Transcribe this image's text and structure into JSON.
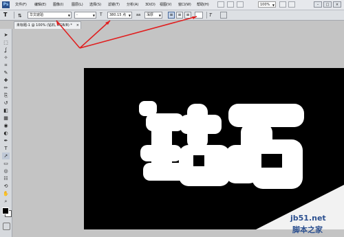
{
  "app": {
    "logo": "Ps"
  },
  "menu": {
    "items": [
      "文件(F)",
      "编辑(E)",
      "图像(I)",
      "图层(L)",
      "选择(S)",
      "滤镜(T)",
      "分析(A)",
      "3D(D)",
      "视图(V)",
      "窗口(W)",
      "帮助(H)"
    ],
    "zoom": "100%",
    "window_buttons": [
      "–",
      "□",
      "×"
    ]
  },
  "options": {
    "tool_icon": "T",
    "orientation_icon": "orientation-toggle-icon",
    "font_family": "华文琥珀",
    "font_style": "-",
    "font_size": "380.15 点",
    "antialias_label": "aa",
    "antialias_value": "浑厚",
    "text_color": "#ffffff"
  },
  "document": {
    "tab_label": "未标题-1 @ 100% (钻石, RGB/8) *",
    "close": "×"
  },
  "canvas": {
    "background": "#000000",
    "text": "钻石",
    "text_color": "#ffffff"
  },
  "toolbox": {
    "tools": [
      "move",
      "marquee",
      "lasso",
      "magic-wand",
      "crop",
      "eyedropper",
      "healing",
      "brush",
      "clone-stamp",
      "history-brush",
      "eraser",
      "gradient",
      "blur",
      "dodge",
      "pen",
      "type",
      "path-select",
      "shape",
      "hand",
      "zoom-3d",
      "orbit",
      "hand-tool",
      "zoom-tool"
    ],
    "foreground_color": "#000000",
    "background_color": "#ffffff"
  },
  "annotation": {
    "arrow_color": "#e02020"
  },
  "watermark": {
    "site": "jb51.net",
    "name": "脚本之家"
  }
}
